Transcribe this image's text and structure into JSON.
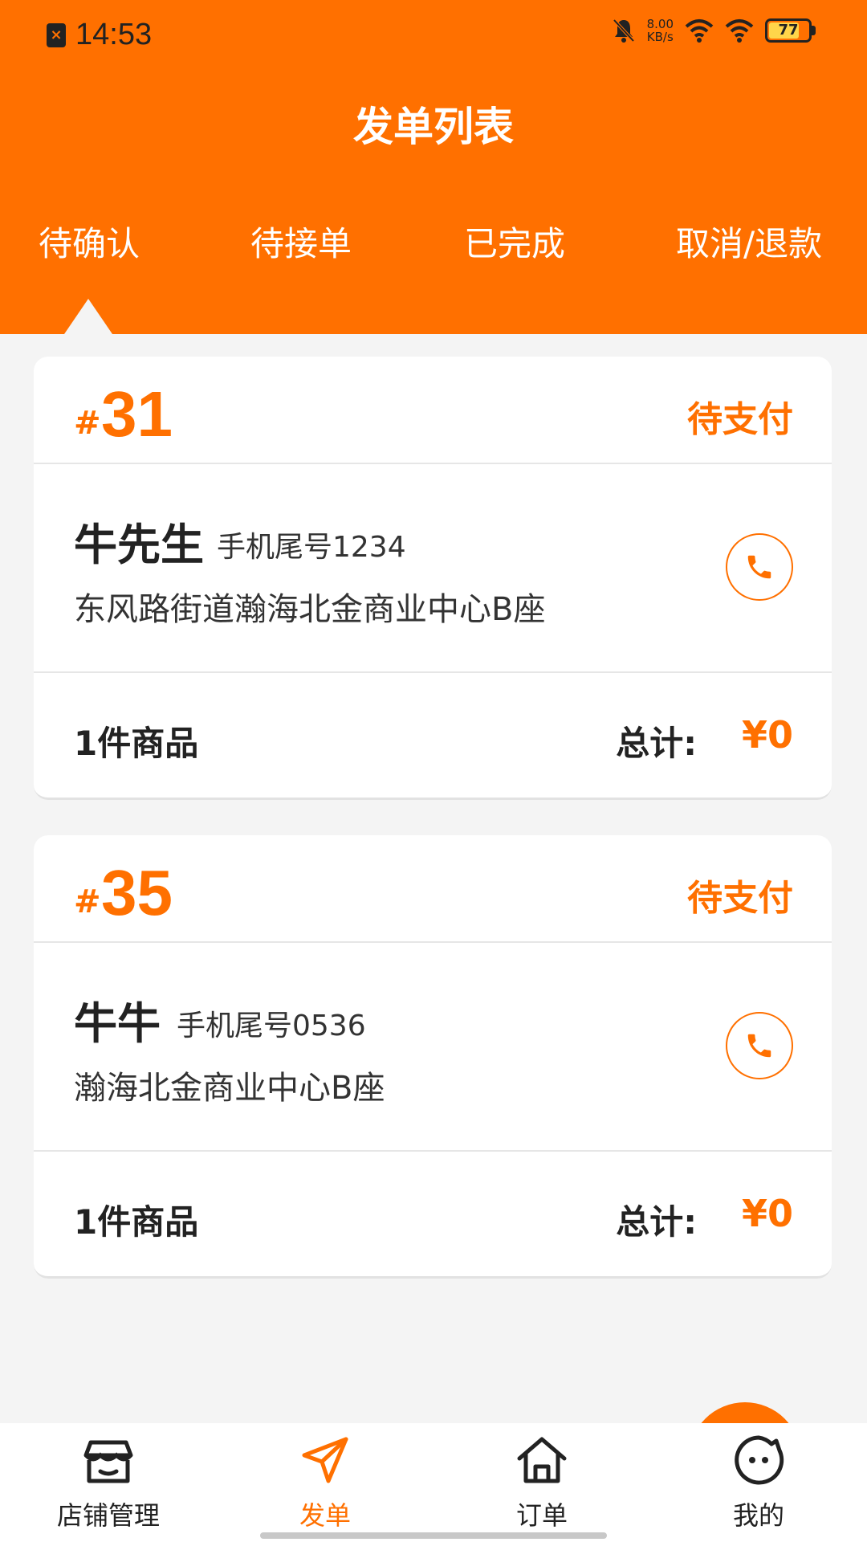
{
  "status_bar": {
    "time": "14:53",
    "speed_value": "8.00",
    "speed_unit": "KB/s",
    "battery": "77",
    "battery_level": 0.77,
    "icons": [
      "sim-icon",
      "mute-bell-icon",
      "wifi-icon",
      "wifi-icon",
      "battery-icon"
    ]
  },
  "header": {
    "title": "发单列表"
  },
  "tabs": [
    {
      "label": "待确认",
      "active": true
    },
    {
      "label": "待接单",
      "active": false
    },
    {
      "label": "已完成",
      "active": false
    },
    {
      "label": "取消/退款",
      "active": false
    }
  ],
  "orders": [
    {
      "hash": "#",
      "number": "31",
      "status": "待支付",
      "customer_name": "牛先生",
      "phone_tail": "手机尾号1234",
      "address": "东风路街道瀚海北金商业中心B座",
      "items": "1件商品",
      "total_label": "总计:",
      "total_value": "¥0"
    },
    {
      "hash": "#",
      "number": "35",
      "status": "待支付",
      "customer_name": "牛牛",
      "phone_tail": "手机尾号0536",
      "address": "瀚海北金商业中心B座",
      "items": "1件商品",
      "total_label": "总计:",
      "total_value": "¥0"
    }
  ],
  "bottom_nav": [
    {
      "label": "店铺管理",
      "icon": "store-icon",
      "active": false
    },
    {
      "label": "发单",
      "icon": "send-icon",
      "active": true
    },
    {
      "label": "订单",
      "icon": "home-icon",
      "active": false
    },
    {
      "label": "我的",
      "icon": "face-icon",
      "active": false
    }
  ],
  "colors": {
    "accent": "#ff7000",
    "background": "#f4f4f4",
    "card": "#ffffff",
    "text": "#222222"
  }
}
